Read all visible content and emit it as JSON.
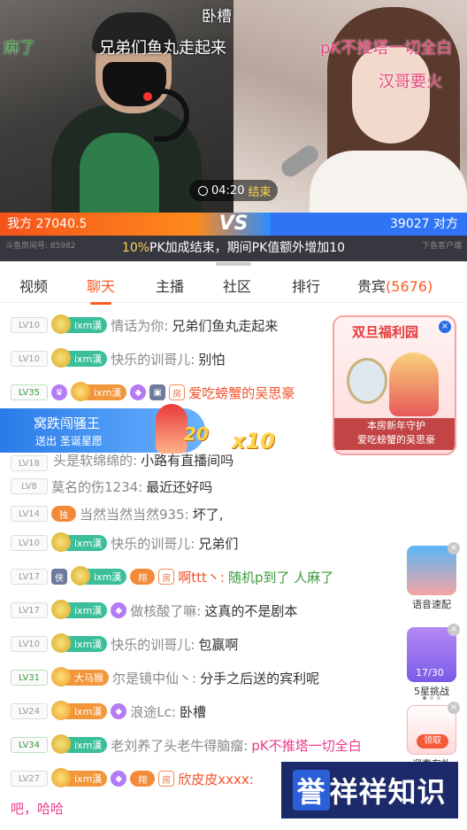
{
  "video": {
    "title": "卧槽",
    "danmaku": [
      "麻了",
      "兄弟们鱼丸走起来",
      "pK不推塔一切全白",
      "汉哥要火"
    ],
    "timer": "04:20",
    "timer_status": "结束",
    "pk": {
      "left_label": "我方",
      "left_score": "27040.5",
      "vs": "VS",
      "right_score": "39027",
      "right_label": "对方",
      "info_pct": "10%",
      "info_text": "PK加成结束，期间PK值额外增加10",
      "room_id": "斗鱼房间号: 85982",
      "room_id2": "下鱼客户端"
    }
  },
  "tabs": [
    {
      "label": "视频"
    },
    {
      "label": "聊天"
    },
    {
      "label": "主播"
    },
    {
      "label": "社区"
    },
    {
      "label": "排行"
    },
    {
      "label": "贵宾",
      "count": "(5676)"
    }
  ],
  "chat": [
    {
      "lv": "LV10",
      "fan": "ixm漢",
      "fan_lv": "9",
      "name": "情话为你:",
      "text": "兄弟们鱼丸走起来"
    },
    {
      "lv": "LV10",
      "fan": "ixm漢",
      "fan_lv": "9",
      "name": "快乐的训哥儿:",
      "text": "别怕"
    },
    {
      "lv": "LV35",
      "fan": "ixm漢",
      "fan_lv": "19",
      "house": "房",
      "name": "爱吃螃蟹的吴思豪",
      "text": ""
    },
    {
      "lv": "LV18",
      "name": "头是软绵绵的:",
      "text": "小路有直播间吗"
    },
    {
      "lv": "LV8",
      "name": "莫名的伤1234:",
      "text": "最近还好吗"
    },
    {
      "lv": "LV14",
      "tag": "独",
      "name": "当然当然当然935:",
      "text": "坏了,"
    },
    {
      "lv": "LV10",
      "fan": "ixm漢",
      "fan_lv": "9",
      "name": "快乐的训哥儿:",
      "text": "兄弟们"
    },
    {
      "lv": "LV17",
      "shield": "侠",
      "fan": "ixm漢",
      "fan_lv": "10",
      "tag": "翔",
      "house": "房",
      "name": "啊ttt丶:",
      "text": "随机p到了 人麻了"
    },
    {
      "lv": "LV17",
      "fan": "ixm漢",
      "fan_lv": "9",
      "name": "做核酸了嘛:",
      "text": "这真的不是剧本"
    },
    {
      "lv": "LV10",
      "fan": "ixm漢",
      "fan_lv": "9",
      "name": "快乐的训哥儿:",
      "text": "包赢啊"
    },
    {
      "lv": "LV31",
      "fan": "大马猴",
      "fan_lv": "8",
      "name": "尔是镜中仙丶:",
      "text": "分手之后送的宾利呢"
    },
    {
      "lv": "LV24",
      "fan": "ixm漢",
      "fan_lv": "15",
      "name": "浪途Lc:",
      "text": "卧槽"
    },
    {
      "lv": "LV34",
      "fan": "ixm漢",
      "fan_lv": "13",
      "name": "老刘养了头老牛得脑瘤:",
      "text": "pK不推塔一切全白"
    },
    {
      "lv": "LV27",
      "fan": "ixm漢",
      "fan_lv": "16",
      "tag": "翔",
      "house": "房",
      "name": "欣皮皮xxxx:",
      "text": ""
    }
  ],
  "chat_cont": "吧，哈哈",
  "gift": {
    "title": "窝跌闯骚王",
    "sub": "送出 圣诞星愿",
    "count1": "20",
    "count2": "x10"
  },
  "fuli": {
    "title": "双旦福利园",
    "guard": "本房新年守护",
    "user": "爱吃螃蟹的吴思豪"
  },
  "side": [
    {
      "label": "语音速配"
    },
    {
      "label": "5星挑战",
      "frac": "17/30"
    },
    {
      "label": "迎春有礼",
      "tag": "领取"
    }
  ],
  "watermark": {
    "a": "誉",
    "b": "祥祥知识"
  },
  "colors": {
    "accent": "#ff5a1f",
    "pk_left": "#f5531b",
    "pk_right": "#2f74f5"
  }
}
